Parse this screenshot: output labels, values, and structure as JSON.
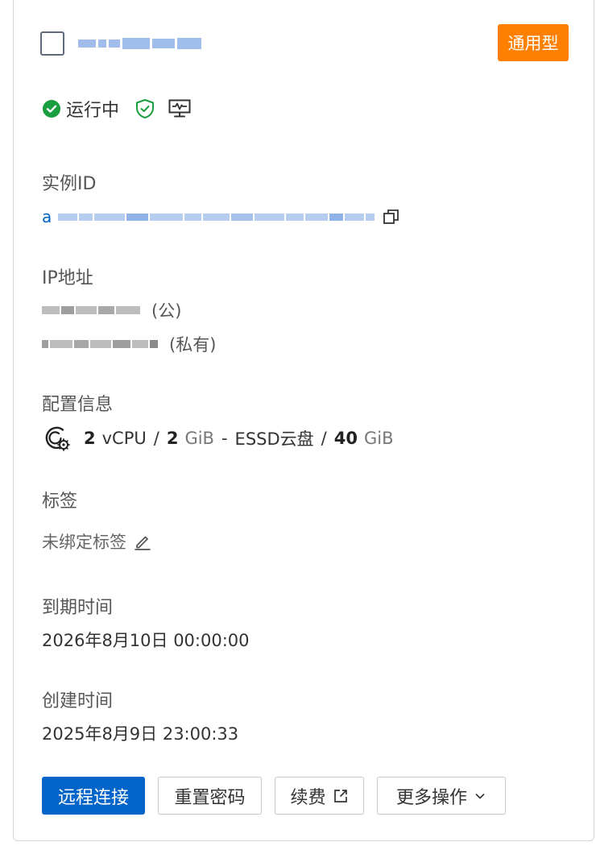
{
  "header": {
    "instance_name": "",
    "type_badge": "通用型",
    "badge_color": "#FF8000"
  },
  "status": {
    "text": "运行中",
    "color": "#1A9E3F",
    "icons": [
      "check-circle-icon",
      "shield-check-icon",
      "monitor-icon"
    ]
  },
  "instance_id": {
    "label": "实例ID",
    "value_prefix": "a",
    "copy_icon": "copy-icon"
  },
  "ip": {
    "label": "IP地址",
    "public_tag": "(公)",
    "private_tag": "(私有)"
  },
  "config": {
    "label": "配置信息",
    "icon": "cpu-settings-icon",
    "vcpu_num": "2",
    "vcpu_unit": "vCPU",
    "mem_num": "2",
    "mem_unit": "GiB",
    "disk_type": "ESSD云盘",
    "disk_num": "40",
    "disk_unit": "GiB",
    "slash": "/",
    "dash": "-"
  },
  "tags": {
    "label": "标签",
    "value": "未绑定标签",
    "edit_icon": "edit-icon"
  },
  "expire": {
    "label": "到期时间",
    "value": "2026年8月10日 00:00:00"
  },
  "created": {
    "label": "创建时间",
    "value": "2025年8月9日 23:00:33"
  },
  "actions": {
    "remote": "远程连接",
    "reset_password": "重置密码",
    "renew": "续费",
    "more": "更多操作",
    "primary_color": "#0064C8"
  }
}
